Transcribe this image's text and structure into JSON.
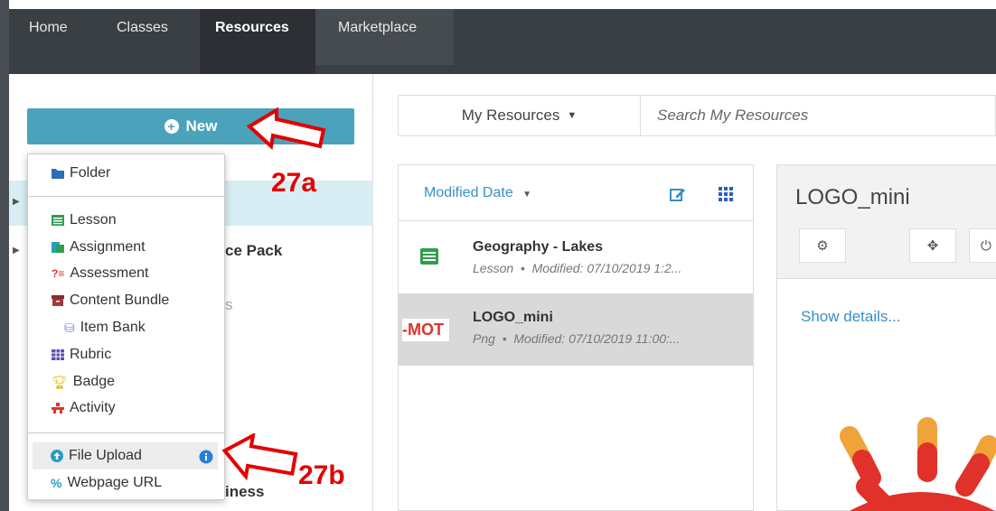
{
  "nav": {
    "items": [
      {
        "label": "Home",
        "active": false
      },
      {
        "label": "Classes",
        "active": false
      },
      {
        "label": "Resources",
        "active": true
      },
      {
        "label": "Marketplace",
        "active": false
      }
    ]
  },
  "sidebar": {
    "new_label": "New",
    "partial_text": {
      "resource_pack": "urce Pack",
      "faded": "s",
      "business": "iness"
    }
  },
  "new_menu": {
    "items": [
      {
        "label": "Folder",
        "icon": "folder-icon"
      },
      {
        "label": "Lesson",
        "icon": "lesson-icon"
      },
      {
        "label": "Assignment",
        "icon": "assignment-icon"
      },
      {
        "label": "Assessment",
        "icon": "assessment-icon"
      },
      {
        "label": "Content Bundle",
        "icon": "content-bundle-icon"
      },
      {
        "label": "Item Bank",
        "icon": "item-bank-icon"
      },
      {
        "label": "Rubric",
        "icon": "rubric-icon"
      },
      {
        "label": "Badge",
        "icon": "trophy-icon"
      },
      {
        "label": "Activity",
        "icon": "activity-icon"
      },
      {
        "label": "File Upload",
        "icon": "upload-icon"
      },
      {
        "label": "Webpage URL",
        "icon": "link-icon"
      }
    ]
  },
  "search": {
    "scope_label": "My Resources",
    "placeholder": "Search My Resources"
  },
  "list": {
    "sort_label": "Modified Date",
    "rows": [
      {
        "title": "Geography - Lakes",
        "type": "Lesson",
        "modified": "Modified: 07/10/2019 1:2...",
        "icon": "lesson-icon"
      },
      {
        "title": "LOGO_mini",
        "type": "Png",
        "modified": "Modified: 07/10/2019 11:00:...",
        "thumb_text": "-MOT",
        "icon": "image-thumbnail"
      }
    ]
  },
  "detail": {
    "title": "LOGO_mini",
    "show_details": "Show details..."
  },
  "annotations": {
    "a": "27a",
    "b": "27b"
  },
  "colors": {
    "nav_bg": "#3a3f44",
    "new_button": "#4aa3bb",
    "link": "#3a8fc7",
    "annotation": "#e30000",
    "logo_red": "#e0322a",
    "logo_orange": "#f0a33a"
  }
}
